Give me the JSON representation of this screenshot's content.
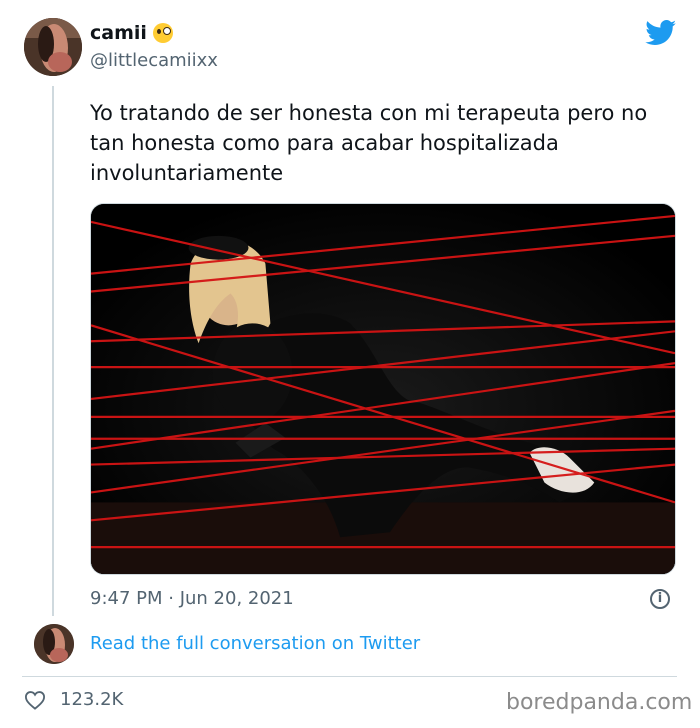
{
  "tweet": {
    "display_name": "camii",
    "handle": "@littlecamiixx",
    "text": "Yo tratando de ser honesta con mi terapeuta pero no tan honesta como para acabar hospitalizada involuntariamente",
    "timestamp": "9:47 PM · Jun 20, 2021",
    "read_full_label": "Read the full conversation on Twitter",
    "likes": "123.2K"
  },
  "icons": {
    "brand": "twitter-bird-icon",
    "emoji": "zany-face-emoji",
    "info": "info-icon",
    "like": "heart-icon"
  },
  "colors": {
    "link": "#1d9bf0",
    "twitter_blue": "#1d9bf0",
    "secondary_text": "#536471",
    "laser_red": "#d41414"
  },
  "watermark": "boredpanda.com"
}
